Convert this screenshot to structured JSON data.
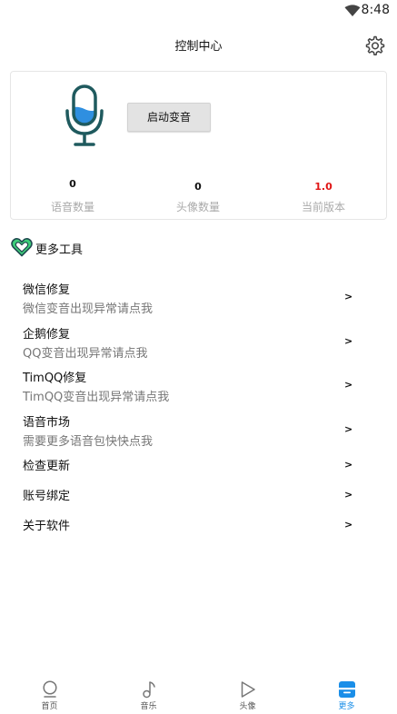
{
  "status_bar": {
    "time": "8:48"
  },
  "header": {
    "title": "控制中心"
  },
  "card": {
    "start_button": "启动变音",
    "stats": [
      {
        "value": "0",
        "label": "语音数量"
      },
      {
        "value": "0",
        "label": "头像数量"
      },
      {
        "value": "1.0",
        "label": "当前版本"
      }
    ]
  },
  "section": {
    "title": "更多工具"
  },
  "menu": [
    {
      "title": "微信修复",
      "subtitle": "微信变音出现异常请点我",
      "chevron": ">"
    },
    {
      "title": "企鹅修复",
      "subtitle": "QQ变音出现异常请点我",
      "chevron": ">"
    },
    {
      "title": "TimQQ修复",
      "subtitle": "TimQQ变音出现异常请点我",
      "chevron": ">"
    },
    {
      "title": "语音市场",
      "subtitle": "需要更多语音包快快点我",
      "chevron": ">"
    },
    {
      "title": "检查更新",
      "chevron": ">"
    },
    {
      "title": "账号绑定",
      "chevron": ">"
    },
    {
      "title": "关于软件",
      "chevron": ">"
    }
  ],
  "bottom_nav": [
    {
      "label": "首页",
      "icon": "home-circle-icon"
    },
    {
      "label": "音乐",
      "icon": "music-note-icon"
    },
    {
      "label": "头像",
      "icon": "play-triangle-icon"
    },
    {
      "label": "更多",
      "icon": "more-box-icon"
    }
  ],
  "colors": {
    "accent": "#1a8ee8",
    "mic_blue": "#2f8fe0",
    "mic_outline": "#1f5a5e",
    "version_red": "#e01515",
    "heart_green": "#3ecf7a"
  }
}
